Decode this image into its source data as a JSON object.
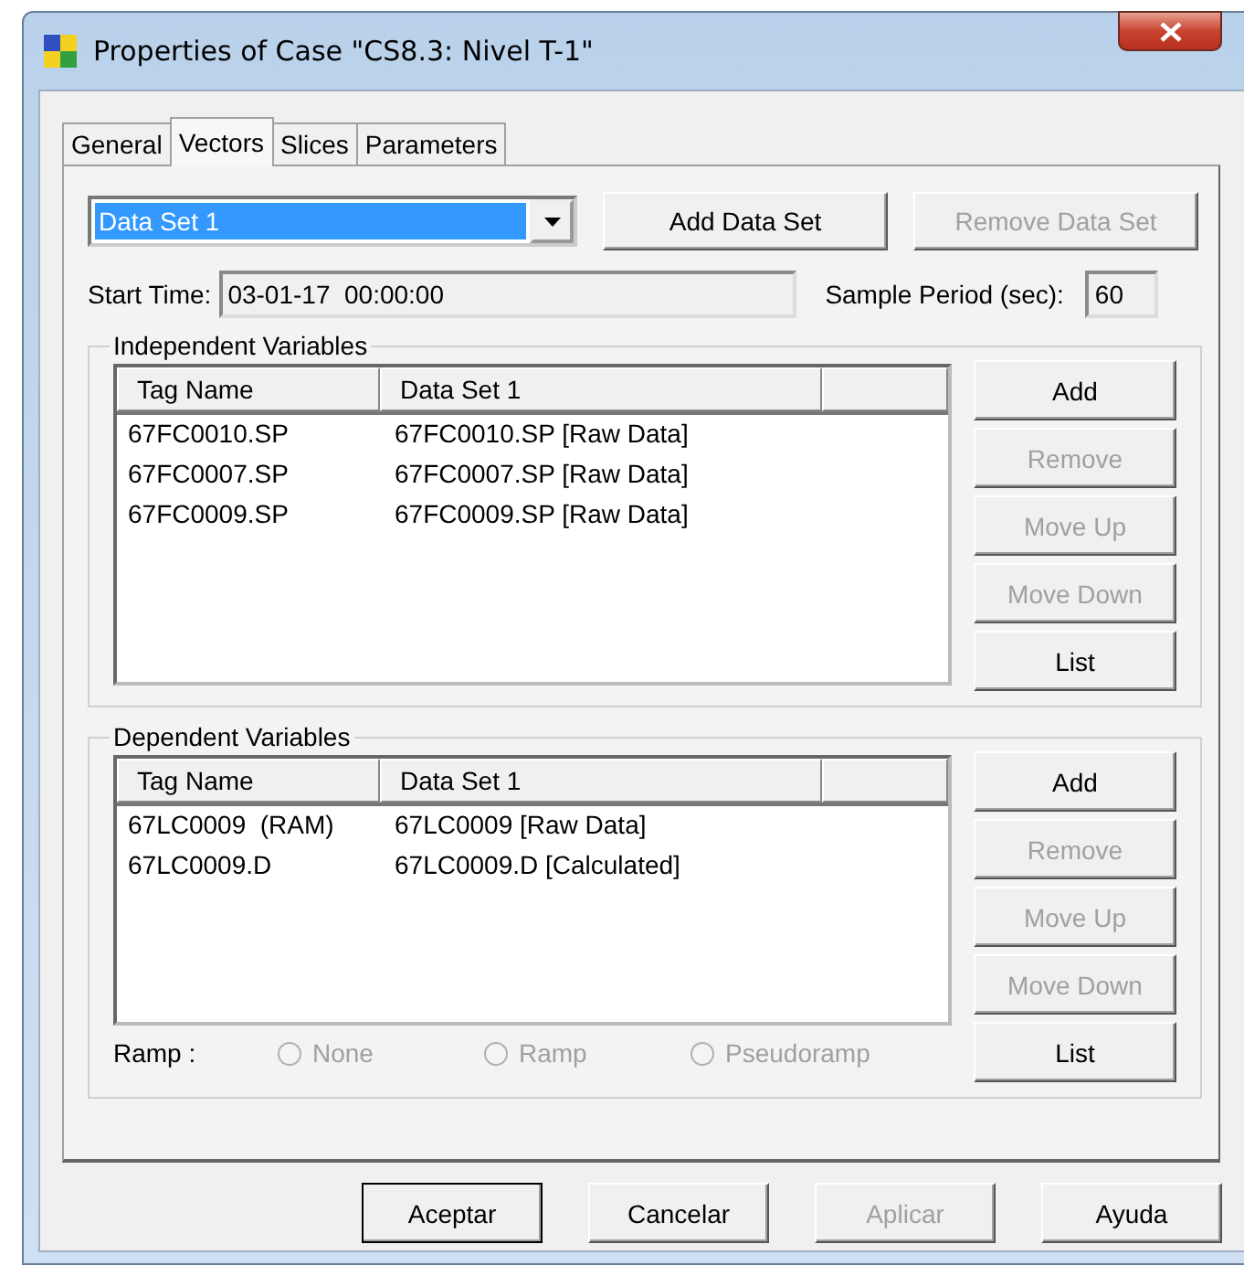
{
  "window": {
    "title": "Properties of Case \"CS8.3: Nivel T-1\""
  },
  "tabs": [
    {
      "label": "General",
      "selected": false
    },
    {
      "label": "Vectors",
      "selected": true
    },
    {
      "label": "Slices",
      "selected": false
    },
    {
      "label": "Parameters",
      "selected": false
    }
  ],
  "data_set": {
    "value": "Data Set 1",
    "buttons": [
      {
        "label": "Add Data Set",
        "disabled": false
      },
      {
        "label": "Remove Data Set",
        "disabled": true
      }
    ]
  },
  "start_time": {
    "label": "Start Time:",
    "value": "03-01-17  00:00:00"
  },
  "sample_period": {
    "label": "Sample Period (sec):",
    "value": "60"
  },
  "groups": [
    {
      "title": "Independent Variables",
      "columns": [
        "Tag Name",
        "Data Set 1"
      ],
      "rows": [
        [
          "67FC0010.SP",
          "67FC0010.SP [Raw Data]"
        ],
        [
          "67FC0007.SP",
          "67FC0007.SP [Raw Data]"
        ],
        [
          "67FC0009.SP",
          "67FC0009.SP [Raw Data]"
        ]
      ],
      "buttons": [
        {
          "label": "Add",
          "disabled": false
        },
        {
          "label": "Remove",
          "disabled": true
        },
        {
          "label": "Move Up",
          "disabled": true
        },
        {
          "label": "Move Down",
          "disabled": true
        },
        {
          "label": "List",
          "disabled": false
        }
      ]
    },
    {
      "title": "Dependent Variables",
      "columns": [
        "Tag Name",
        "Data Set 1"
      ],
      "rows": [
        [
          "67LC0009  (RAM)",
          "67LC0009 [Raw Data]"
        ],
        [
          "67LC0009.D",
          "67LC0009.D [Calculated]"
        ]
      ],
      "buttons": [
        {
          "label": "Add",
          "disabled": false
        },
        {
          "label": "Remove",
          "disabled": true
        },
        {
          "label": "Move Up",
          "disabled": true
        },
        {
          "label": "Move Down",
          "disabled": true
        },
        {
          "label": "List",
          "disabled": false
        }
      ],
      "ramp": {
        "label": "Ramp :",
        "options": [
          {
            "label": "None",
            "selected": false,
            "disabled": true
          },
          {
            "label": "Ramp",
            "selected": false,
            "disabled": true
          },
          {
            "label": "Pseudoramp",
            "selected": false,
            "disabled": true
          }
        ]
      }
    }
  ],
  "footer_buttons": [
    {
      "label": "Aceptar",
      "disabled": false,
      "default": true
    },
    {
      "label": "Cancelar",
      "disabled": false,
      "default": false
    },
    {
      "label": "Aplicar",
      "disabled": true,
      "default": false
    },
    {
      "label": "Ayuda",
      "disabled": false,
      "default": false
    }
  ]
}
